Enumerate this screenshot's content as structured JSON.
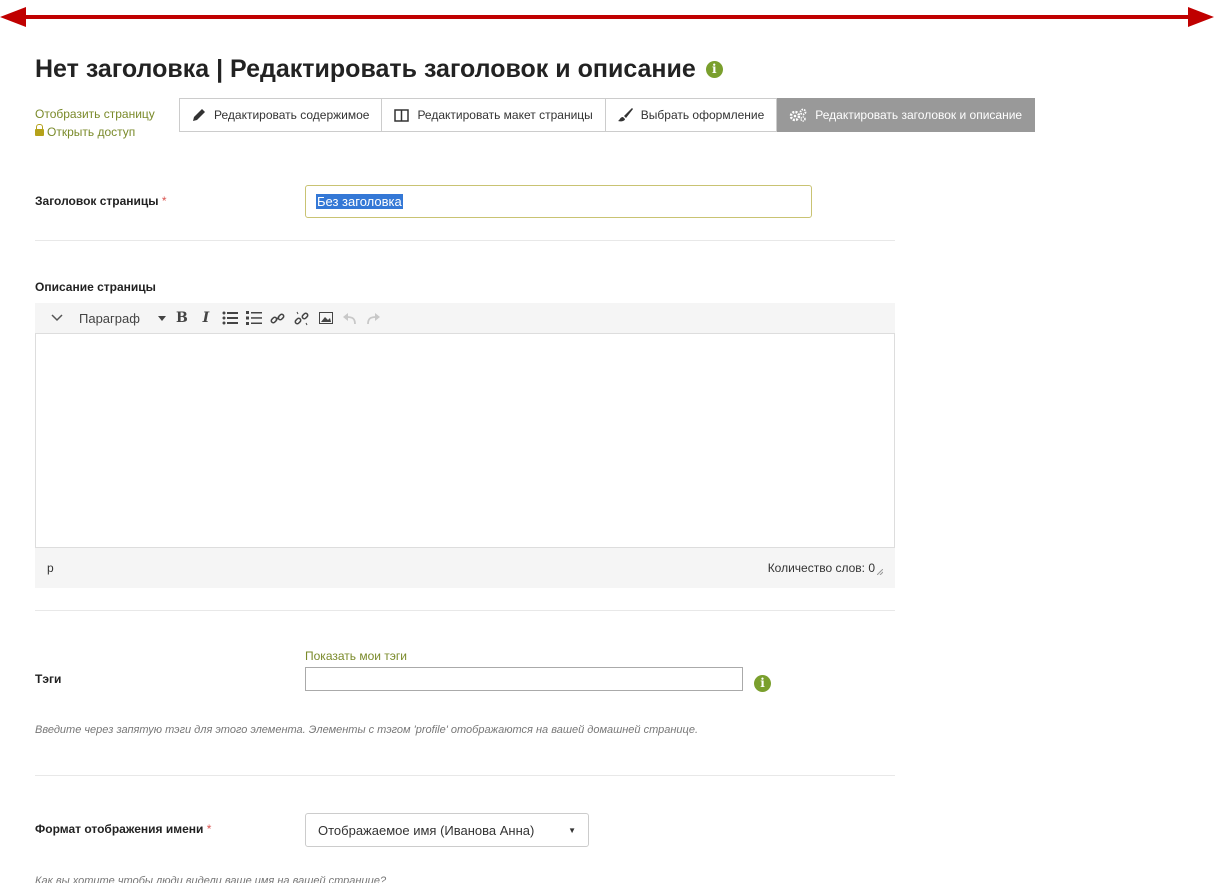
{
  "page": {
    "title": "Нет заголовка | Редактировать заголовок и описание"
  },
  "side_links": {
    "display_page": "Отобразить страницу",
    "open_access": "Открыть доступ"
  },
  "tabs": [
    {
      "label": "Редактировать содержимое",
      "icon": "pencil-icon",
      "active": false
    },
    {
      "label": "Редактировать макет страницы",
      "icon": "layout-icon",
      "active": false
    },
    {
      "label": "Выбрать оформление",
      "icon": "brush-icon",
      "active": false
    },
    {
      "label": "Редактировать заголовок и описание",
      "icon": "cogs-icon",
      "active": true
    }
  ],
  "form": {
    "title_label": "Заголовок страницы",
    "required_mark": "*",
    "title_value": "Без заголовка",
    "description_label": "Описание страницы",
    "editor": {
      "format_label": "Параграф",
      "bold": "B",
      "italic": "I",
      "status_path": "p",
      "word_count": "Количество слов: 0"
    },
    "tags_label": "Тэги",
    "show_tags": "Показать мои тэги",
    "tags_value": "",
    "tags_help": "Введите через запятую тэги для этого элемента. Элементы с тэгом 'profile' отображаются на вашей домашней странице.",
    "name_format_label": "Формат отображения имени",
    "name_format_value": "Отображаемое имя (Иванова Анна)",
    "name_format_help": "Как вы хотите чтобы люди видели ваше имя на вашей странице?"
  },
  "colors": {
    "arrow": "#c00000",
    "accent": "#7a9f2d",
    "active_tab": "#999999"
  }
}
